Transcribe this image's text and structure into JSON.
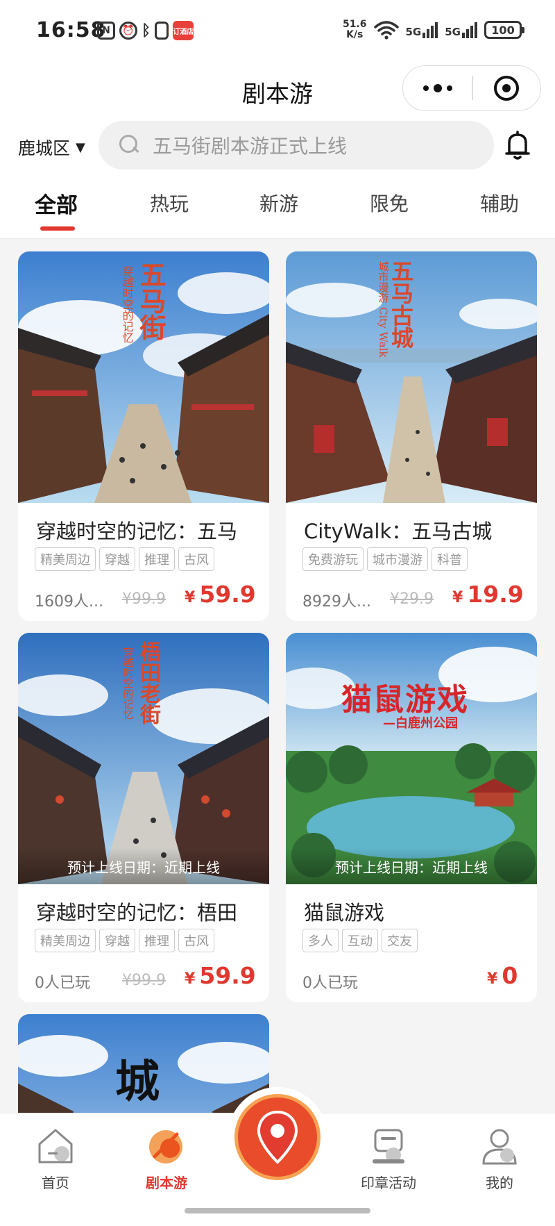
{
  "status_bar": {
    "time": "16:58",
    "speed_value": "51.6",
    "speed_unit": "K/s",
    "sig1_label": "5G",
    "sig2_label": "5G",
    "battery": "100",
    "app_badge": "订酒店"
  },
  "navbar": {
    "title": "剧本游"
  },
  "search": {
    "district": "鹿城区",
    "placeholder": "五马街剧本游正式上线"
  },
  "tabs": [
    {
      "label": "全部",
      "active": true
    },
    {
      "label": "热玩"
    },
    {
      "label": "新游"
    },
    {
      "label": "限免"
    },
    {
      "label": "辅助"
    }
  ],
  "cards": [
    {
      "title": "穿越时空的记忆：五马",
      "tags": [
        "精美周边",
        "穿越",
        "推理",
        "古风"
      ],
      "meta": "1609人...",
      "old_price": "¥99.9",
      "price_symbol": "¥",
      "price": "59.9",
      "poster_title": "五马街",
      "poster_sub": "穿越时空的记忆"
    },
    {
      "title": "CityWalk：五马古城",
      "tags": [
        "免费游玩",
        "城市漫游",
        "科普"
      ],
      "meta": "8929人...",
      "old_price": "¥29.9",
      "price_symbol": "¥",
      "price": "19.9",
      "poster_title": "五马古城",
      "poster_sub": "城市漫游",
      "poster_sub2": "City Walk"
    },
    {
      "title": "穿越时空的记忆：梧田",
      "tags": [
        "精美周边",
        "穿越",
        "推理",
        "古风"
      ],
      "meta": "0人已玩",
      "old_price": "¥99.9",
      "price_symbol": "¥",
      "price": "59.9",
      "soon": "预计上线日期：近期上线",
      "poster_title": "梧田老街",
      "poster_sub": "穿越时空的记忆"
    },
    {
      "title": "猫鼠游戏",
      "tags": [
        "多人",
        "互动",
        "交友"
      ],
      "meta": "0人已玩",
      "price_symbol": "¥",
      "price": "0",
      "soon": "预计上线日期：近期上线",
      "poster_title": "猫鼠游戏",
      "poster_sub": "—白鹿州公园"
    },
    {
      "poster_title": "城"
    }
  ],
  "bottom_nav": [
    {
      "label": "首页",
      "icon": "home-icon"
    },
    {
      "label": "剧本游",
      "icon": "script-tour-icon",
      "active": true
    },
    {
      "label": "",
      "icon": "map-pin-icon"
    },
    {
      "label": "印章活动",
      "icon": "stamp-icon"
    },
    {
      "label": "我的",
      "icon": "profile-icon"
    }
  ],
  "colors": {
    "accent": "#e0382f",
    "background": "#f4f4f4"
  }
}
